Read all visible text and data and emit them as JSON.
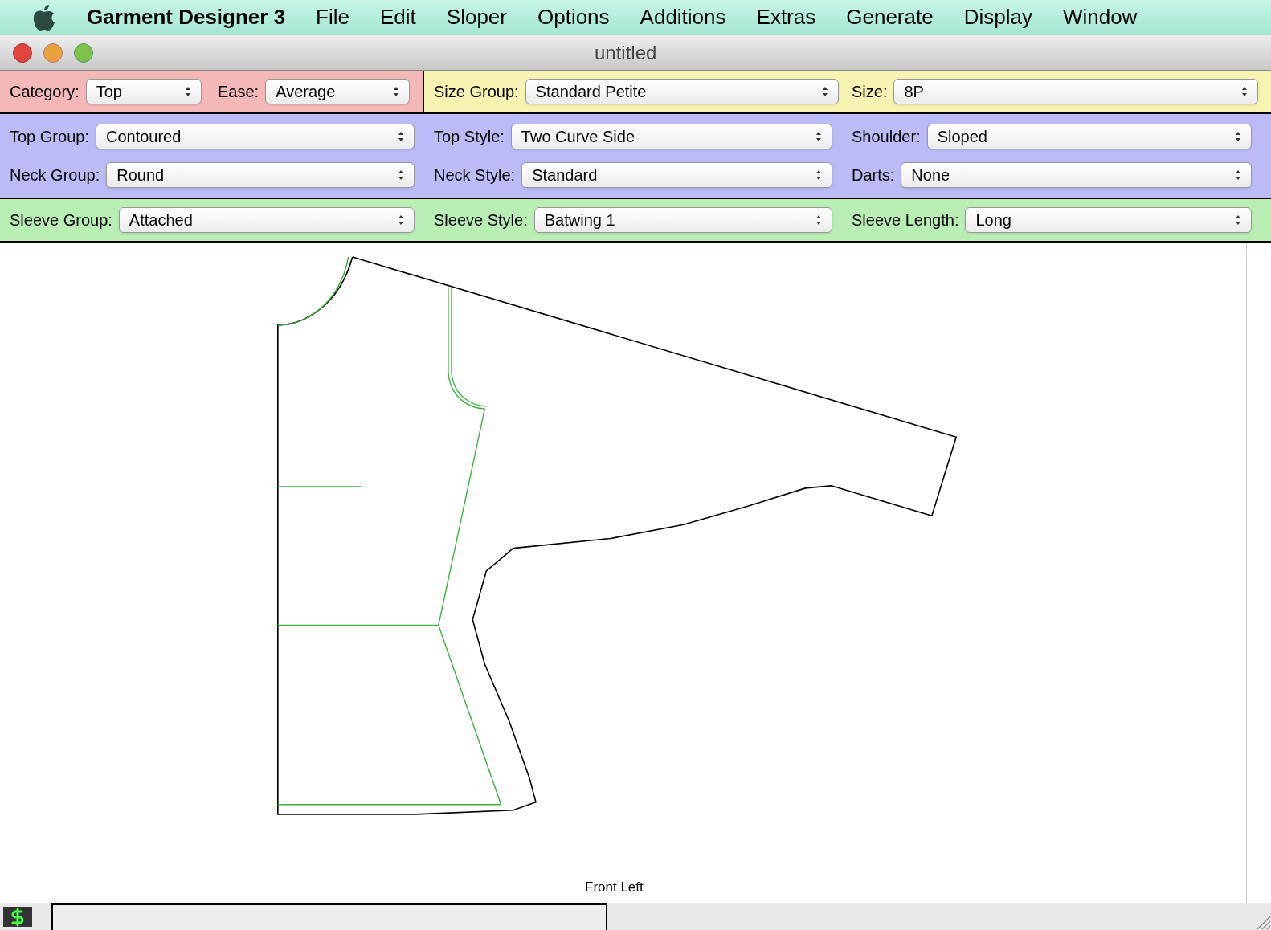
{
  "menu_bar": {
    "app_name": "Garment Designer 3",
    "items": [
      "File",
      "Edit",
      "Sloper",
      "Options",
      "Additions",
      "Extras",
      "Generate",
      "Display",
      "Window"
    ]
  },
  "window": {
    "title": "untitled"
  },
  "basics": [
    {
      "label": "Category:",
      "value": "Top"
    },
    {
      "label": "Ease:",
      "value": "Average"
    }
  ],
  "sizing": [
    {
      "label": "Size Group:",
      "value": "Standard Petite"
    },
    {
      "label": "Size:",
      "value": "8P"
    }
  ],
  "body": [
    [
      {
        "label": "Top Group:",
        "value": "Contoured"
      },
      {
        "label": "Top Style:",
        "value": "Two Curve Side"
      },
      {
        "label": "Shoulder:",
        "value": "Sloped"
      }
    ],
    [
      {
        "label": "Neck Group:",
        "value": "Round"
      },
      {
        "label": "Neck Style:",
        "value": "Standard"
      },
      {
        "label": "Darts:",
        "value": "None"
      }
    ]
  ],
  "sleeve": [
    {
      "label": "Sleeve Group:",
      "value": "Attached"
    },
    {
      "label": "Sleeve Style:",
      "value": "Batwing 1"
    },
    {
      "label": "Sleeve Length:",
      "value": "Long"
    }
  ],
  "canvas": {
    "piece_label": "Front Left"
  }
}
